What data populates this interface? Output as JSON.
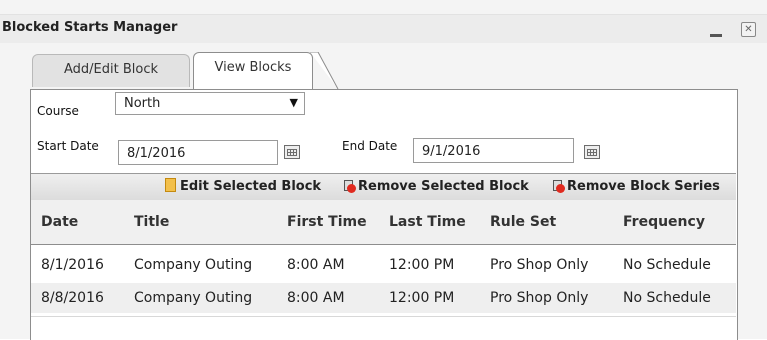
{
  "window": {
    "title": "Blocked Starts Manager"
  },
  "tabs": [
    {
      "label": "Add/Edit Block"
    },
    {
      "label": "View Blocks"
    }
  ],
  "filters": {
    "course_label": "Course",
    "course_value": "North",
    "start_date_label": "Start Date",
    "start_date_value": "8/1/2016",
    "end_date_label": "End Date",
    "end_date_value": "9/1/2016"
  },
  "toolbar": {
    "edit_label": "Edit Selected Block",
    "remove_label": "Remove Selected Block",
    "remove_series_label": "Remove Block Series"
  },
  "table": {
    "columns": [
      "Date",
      "Title",
      "First Time",
      "Last Time",
      "Rule Set",
      "Frequency"
    ],
    "rows": [
      [
        "8/1/2016",
        "Company Outing",
        "8:00 AM",
        "12:00 PM",
        "Pro Shop Only",
        "No Schedule"
      ],
      [
        "8/8/2016",
        "Company Outing",
        "8:00 AM",
        "12:00 PM",
        "Pro Shop Only",
        "No Schedule"
      ]
    ]
  },
  "icons": {
    "edit": "edit-document-icon",
    "remove": "remove-trash-icon",
    "calendar": "calendar-icon",
    "minimize": "minimize-icon",
    "close": "close-icon"
  }
}
